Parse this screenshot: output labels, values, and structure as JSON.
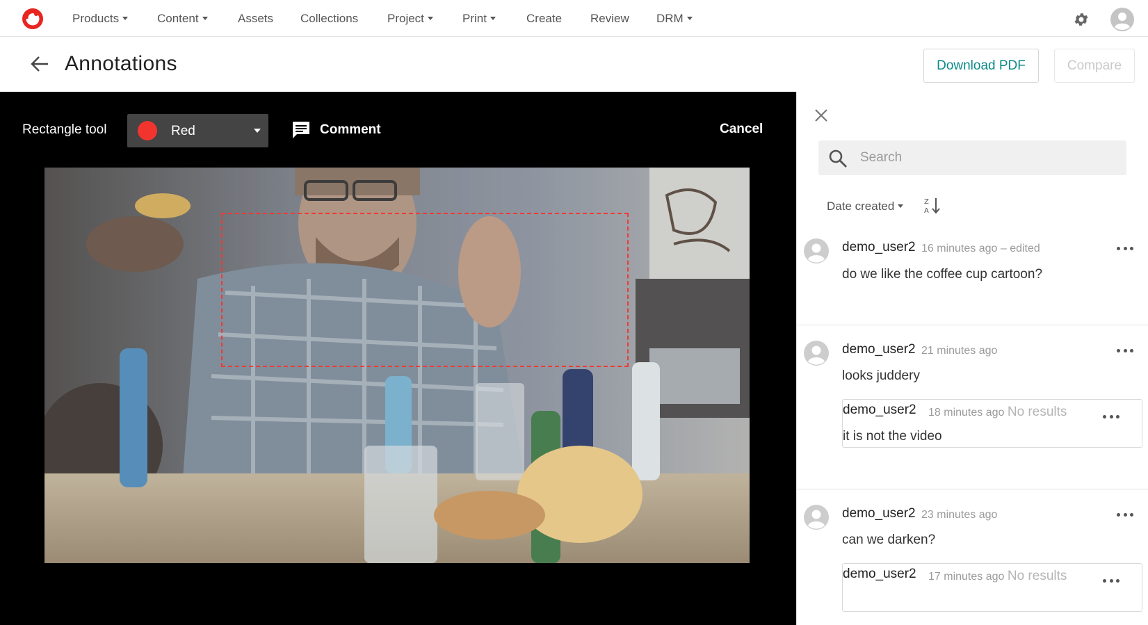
{
  "nav": {
    "items": [
      {
        "label": "Products",
        "dropdown": true
      },
      {
        "label": "Content",
        "dropdown": true
      },
      {
        "label": "Assets",
        "dropdown": false
      },
      {
        "label": "Collections",
        "dropdown": false
      },
      {
        "label": "Project",
        "dropdown": true
      },
      {
        "label": "Print",
        "dropdown": true
      },
      {
        "label": "Create",
        "dropdown": false
      },
      {
        "label": "Review",
        "dropdown": false
      },
      {
        "label": "DRM",
        "dropdown": true
      }
    ],
    "icons": {
      "logo": "brand-logo-icon",
      "settings": "gear-icon",
      "user": "avatar-icon"
    }
  },
  "header": {
    "title": "Annotations",
    "download_label": "Download PDF",
    "compare_label": "Compare"
  },
  "toolbar": {
    "tool_label": "Rectangle tool",
    "color_value": "Red",
    "color_hex": "#f2342f",
    "comment_label": "Comment",
    "cancel_label": "Cancel"
  },
  "panel": {
    "search_placeholder": "Search",
    "sort_label": "Date created",
    "comments": [
      {
        "user": "demo_user2",
        "time": "16 minutes ago",
        "edited": "– edited",
        "text": "do we like the coffee cup cartoon?"
      },
      {
        "user": "demo_user2",
        "time": "21 minutes ago",
        "text": "looks juddery",
        "reply": {
          "user": "demo_user2",
          "time": "18 minutes ago",
          "status": "No results",
          "text": "it is not the video"
        }
      },
      {
        "user": "demo_user2",
        "time": "23 minutes ago",
        "text": "can we darken?",
        "reply": {
          "user": "demo_user2",
          "time": "17 minutes ago",
          "status": "No results"
        }
      }
    ]
  },
  "colors": {
    "accent": "#0a8a88",
    "annotation": "#f03a33",
    "brand": "#e8251f"
  }
}
